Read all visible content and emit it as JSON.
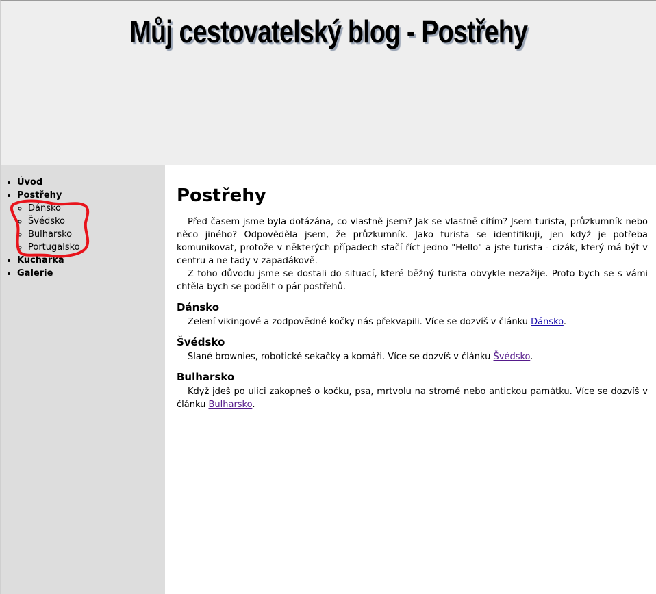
{
  "header": {
    "title": "Můj cestovatelský blog - Postřehy"
  },
  "nav": {
    "items": [
      {
        "label": "Úvod"
      },
      {
        "label": "Postřehy"
      },
      {
        "label": "Kuchařka"
      },
      {
        "label": "Galerie"
      }
    ],
    "subitems": [
      {
        "label": "Dánsko"
      },
      {
        "label": "Švédsko"
      },
      {
        "label": "Bulharsko"
      },
      {
        "label": "Portugalsko"
      }
    ]
  },
  "main": {
    "title": "Postřehy",
    "intro": [
      "Před časem jsme byla dotázána, co vlastně jsem? Jak se vlastně cítím? Jsem turista, průzkumník nebo něco jiného? Odpověděla jsem, že průzkumník. Jako turista se identifikuji, jen když je potřeba komunikovat, protože v některých případech stačí říct jedno \"Hello\" a jste turista - cizák, který má být v centru a ne tady v zapadákově.",
      "Z toho důvodu jsme se dostali do situací, které běžný turista obvykle nezažije. Proto bych se s vámi chtěla bych se podělit o pár postřehů."
    ],
    "sections": [
      {
        "heading": "Dánsko",
        "text": "Zelení vikingové a zodpovědné kočky nás překvapili. Více se dozvíš v článku ",
        "link": "Dánsko",
        "tail": "."
      },
      {
        "heading": "Švédsko",
        "text": "Slané brownies, robotické sekačky a komáři. Více se dozvíš v článku ",
        "link": "Švédsko",
        "tail": "."
      },
      {
        "heading": "Bulharsko",
        "text": "Když jdeš po ulici zakopneš o kočku, psa, mrtvolu na stromě nebo antickou památku. Více se dozvíš v článku ",
        "link": "Bulharsko",
        "tail": "."
      }
    ]
  },
  "colors": {
    "header_bg": "#eeeeee",
    "sidebar_bg": "#dddddd",
    "annotation": "#e8141c",
    "link": "#1a0dab",
    "link_visited": "#551a8b"
  }
}
